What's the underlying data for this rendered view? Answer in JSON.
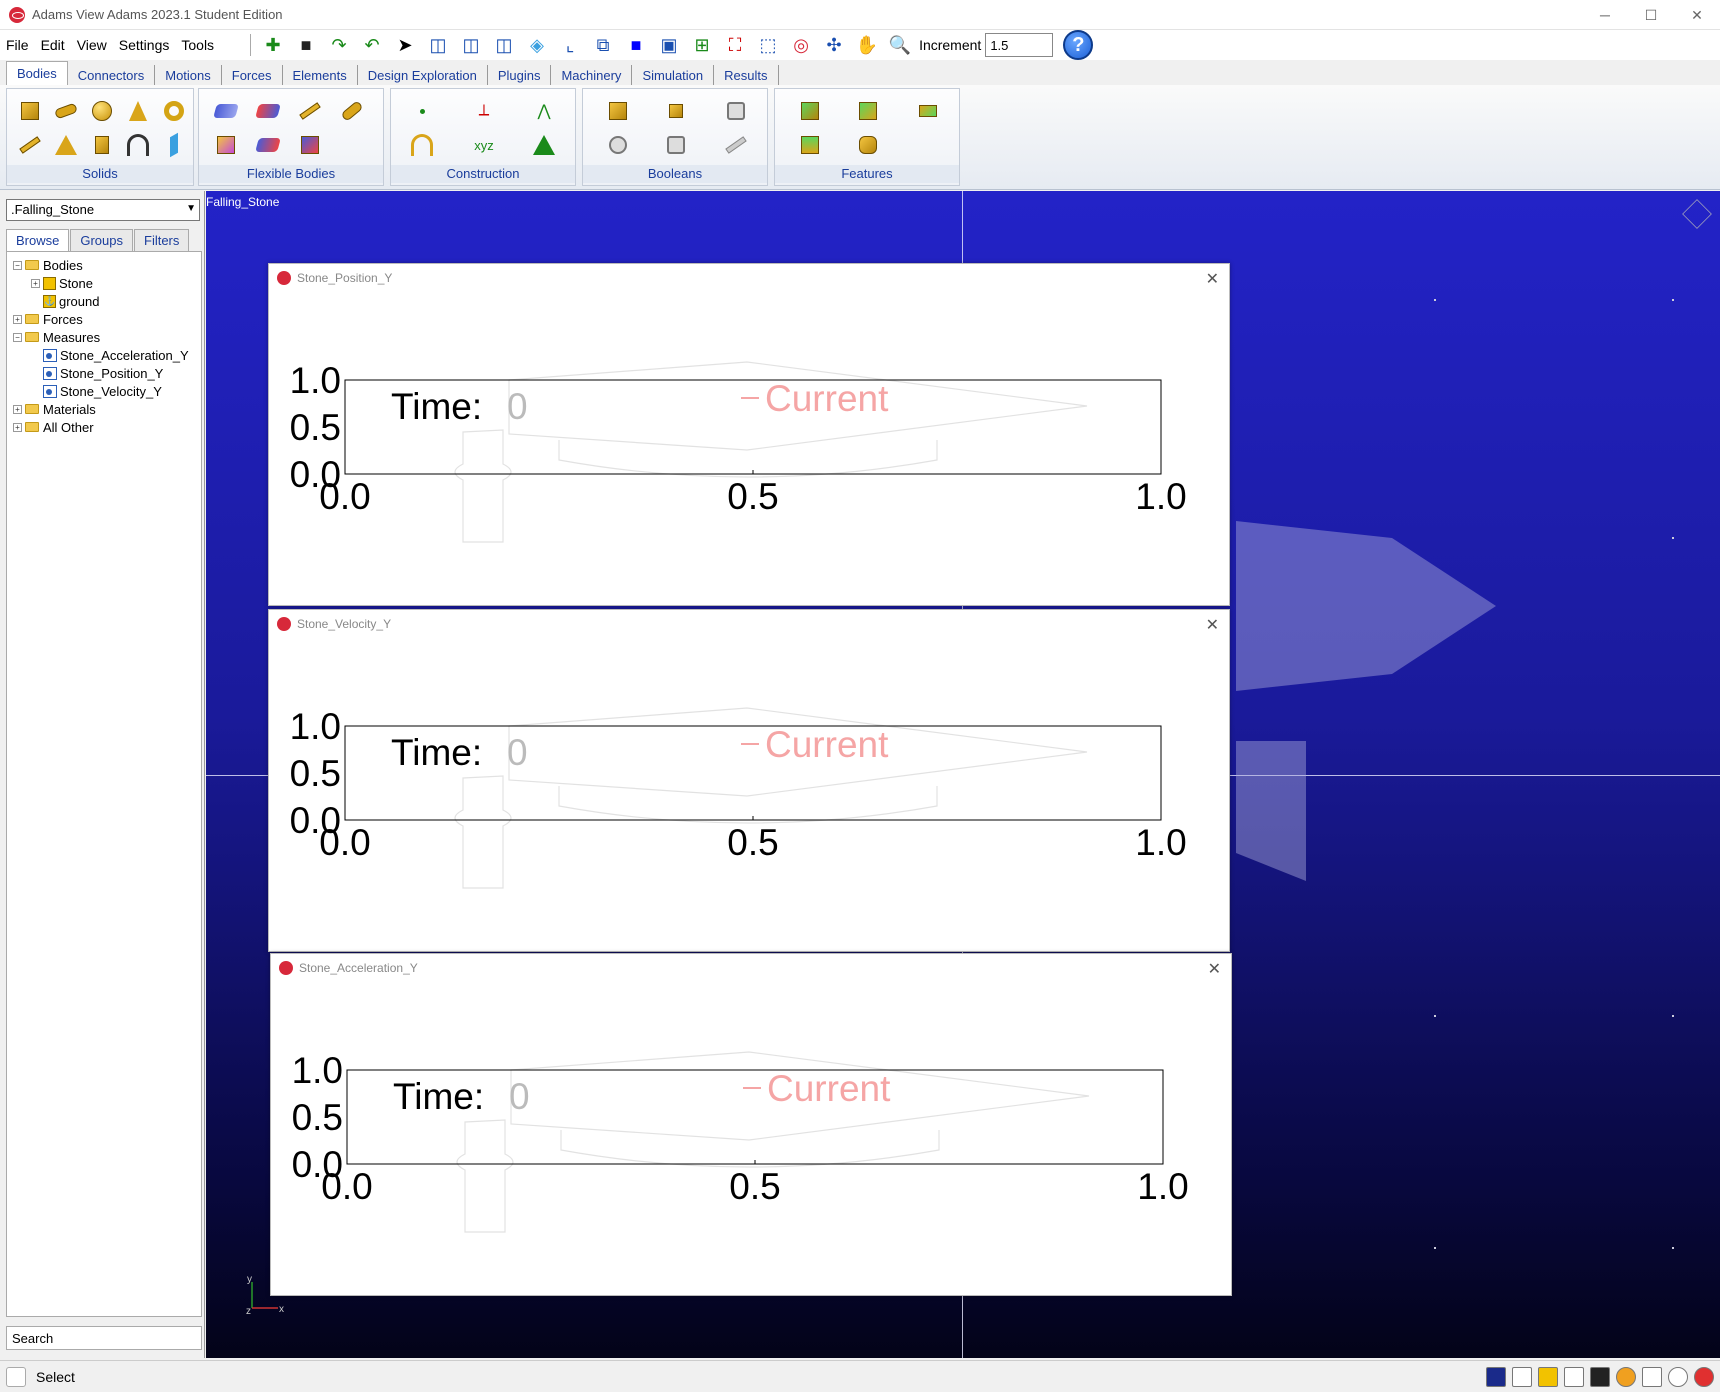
{
  "window": {
    "title": "Adams  View Adams 2023.1 Student Edition",
    "minimize": "─",
    "maximize": "☐",
    "close": "✕"
  },
  "menu": [
    "File",
    "Edit",
    "View",
    "Settings",
    "Tools"
  ],
  "toolbar": {
    "increment_label": "Increment",
    "increment_value": "1.5",
    "help": "?"
  },
  "ribbon_tabs": [
    "Bodies",
    "Connectors",
    "Motions",
    "Forces",
    "Elements",
    "Design Exploration",
    "Plugins",
    "Machinery",
    "Simulation",
    "Results"
  ],
  "ribbon_groups": [
    "Solids",
    "Flexible Bodies",
    "Construction",
    "Booleans",
    "Features"
  ],
  "construction_label": "xyz",
  "browser": {
    "model": ".Falling_Stone",
    "tabs": [
      "Browse",
      "Groups",
      "Filters"
    ],
    "tree": {
      "bodies": "Bodies",
      "stone": "Stone",
      "ground": "ground",
      "forces": "Forces",
      "measures": "Measures",
      "m1": "Stone_Acceleration_Y",
      "m2": "Stone_Position_Y",
      "m3": "Stone_Velocity_Y",
      "materials": "Materials",
      "all_other": "All Other"
    },
    "search": "Search"
  },
  "viewport": {
    "title": "Falling_Stone",
    "axis_x": "x",
    "axis_y": "y",
    "axis_z": "z"
  },
  "plots": [
    {
      "title": "Stone_Position_Y",
      "time_label": "Time:",
      "time_value": "0",
      "legend": "Current"
    },
    {
      "title": "Stone_Velocity_Y",
      "time_label": "Time:",
      "time_value": "0",
      "legend": "Current"
    },
    {
      "title": "Stone_Acceleration_Y",
      "time_label": "Time:",
      "time_value": "0",
      "legend": "Current"
    }
  ],
  "chart_data": [
    {
      "type": "line",
      "title": "",
      "xlabel": "",
      "ylabel": "",
      "xlim": [
        0.0,
        1.0
      ],
      "ylim": [
        0.0,
        1.0
      ],
      "x_ticks": [
        "0.0",
        "0.5",
        "1.0"
      ],
      "y_ticks": [
        "0.0",
        "0.5",
        "1.0"
      ],
      "series": []
    },
    {
      "type": "line",
      "title": "",
      "xlabel": "",
      "ylabel": "",
      "xlim": [
        0.0,
        1.0
      ],
      "ylim": [
        0.0,
        1.0
      ],
      "x_ticks": [
        "0.0",
        "0.5",
        "1.0"
      ],
      "y_ticks": [
        "0.0",
        "0.5",
        "1.0"
      ],
      "series": []
    },
    {
      "type": "line",
      "title": "",
      "xlabel": "",
      "ylabel": "",
      "xlim": [
        0.0,
        1.0
      ],
      "ylim": [
        0.0,
        1.0
      ],
      "x_ticks": [
        "0.0",
        "0.5",
        "1.0"
      ],
      "y_ticks": [
        "0.0",
        "0.5",
        "1.0"
      ],
      "series": []
    }
  ],
  "status": {
    "text": "Select"
  },
  "colors": {
    "viewport_top": "#2323c8",
    "viewport_bottom": "#030318",
    "tab_text": "#1a3d9c",
    "brand": "#d7283a"
  }
}
